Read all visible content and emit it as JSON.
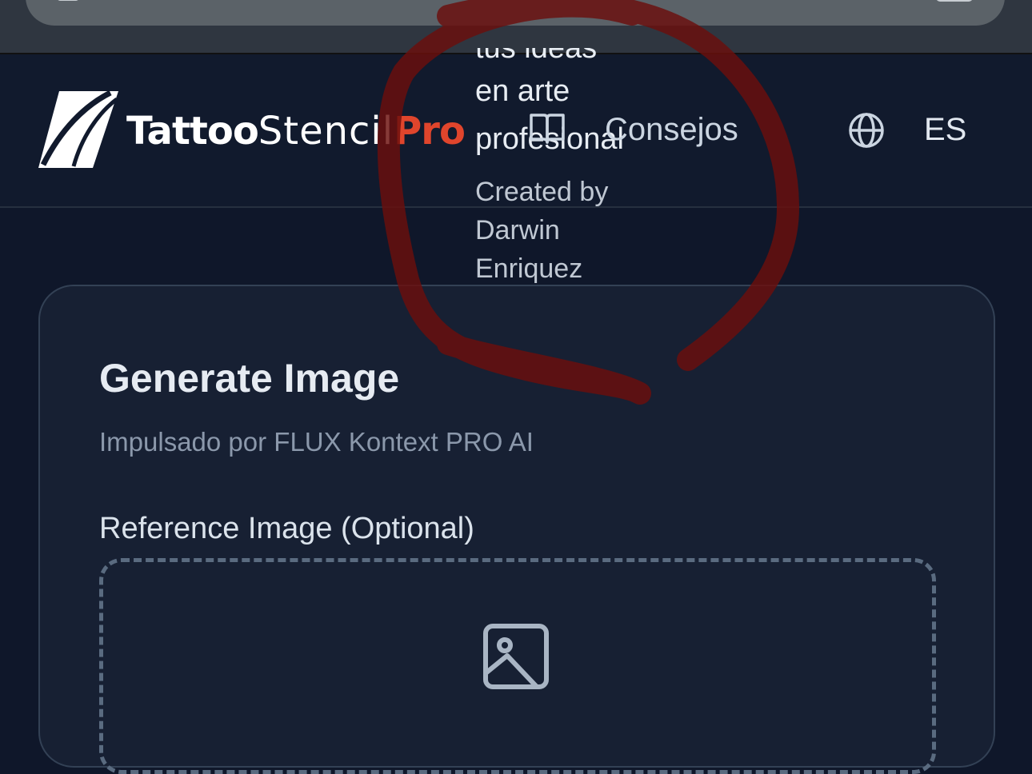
{
  "browser": {},
  "header": {
    "logo": {
      "part1": "Tattoo",
      "part2": "Stencil",
      "part3": "Pro",
      "accent_color": "#e0452c"
    },
    "tagline_lines": [
      "tus ideas",
      "en arte",
      "profesional"
    ],
    "credit_lines": [
      "Created by",
      "Darwin",
      "Enriquez"
    ],
    "nav": {
      "tips_label": "Consejos",
      "tips_icon": "book-icon"
    },
    "language": {
      "icon": "globe-icon",
      "code": "ES"
    }
  },
  "card": {
    "title": "Generate Image",
    "subtitle": "Impulsado por FLUX Kontext PRO AI",
    "reference_label": "Reference Image (Optional)",
    "dropzone_icon": "image-icon"
  },
  "colors": {
    "background": "#0f172a",
    "header": "#111a2d",
    "card": "#172033",
    "annotation_stroke": "#6b0f0c"
  }
}
